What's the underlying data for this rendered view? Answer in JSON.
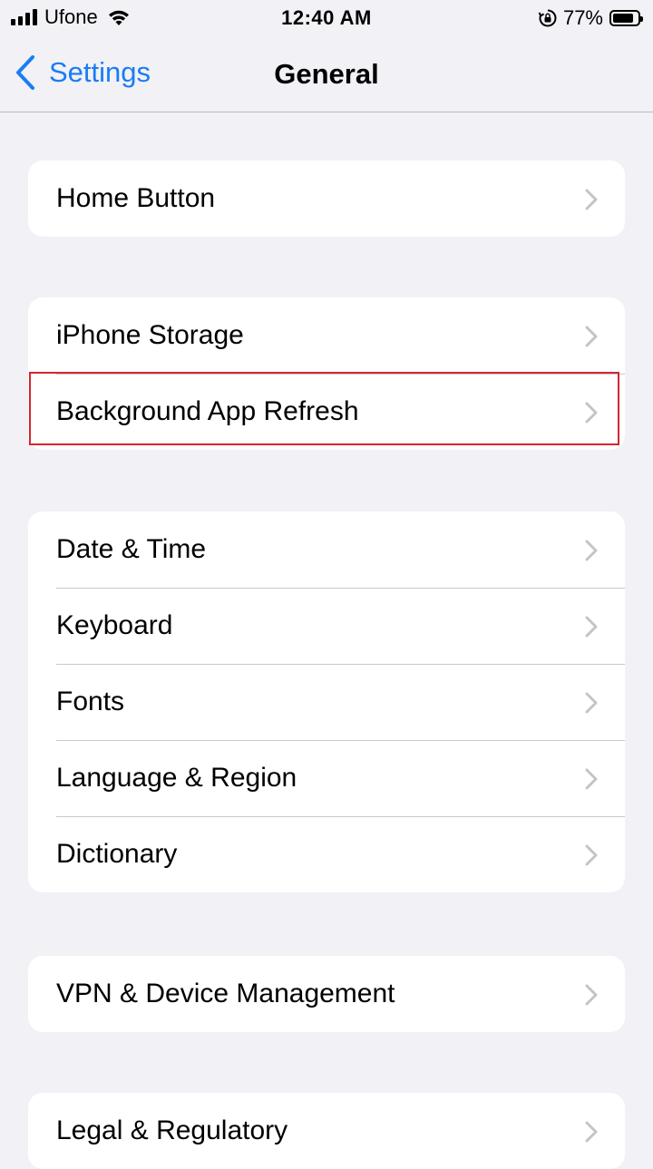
{
  "status_bar": {
    "carrier": "Ufone",
    "time": "12:40 AM",
    "battery_percent": "77%",
    "battery_level": 0.77,
    "signal_bars": 4,
    "icons": [
      "signal-icon",
      "wifi-icon",
      "rotation-lock-icon",
      "battery-icon"
    ]
  },
  "nav": {
    "back_label": "Settings",
    "title": "General"
  },
  "groups": {
    "g1": [
      "Home Button"
    ],
    "g2": [
      "iPhone Storage",
      "Background App Refresh"
    ],
    "g3": [
      "Date & Time",
      "Keyboard",
      "Fonts",
      "Language & Region",
      "Dictionary"
    ],
    "g4": [
      "VPN & Device Management"
    ],
    "g5": [
      "Legal & Regulatory"
    ]
  },
  "highlighted_item": "Background App Refresh",
  "colors": {
    "accent": "#1a7cf4",
    "background": "#f1f1f6",
    "highlight_border": "#d4262f"
  }
}
